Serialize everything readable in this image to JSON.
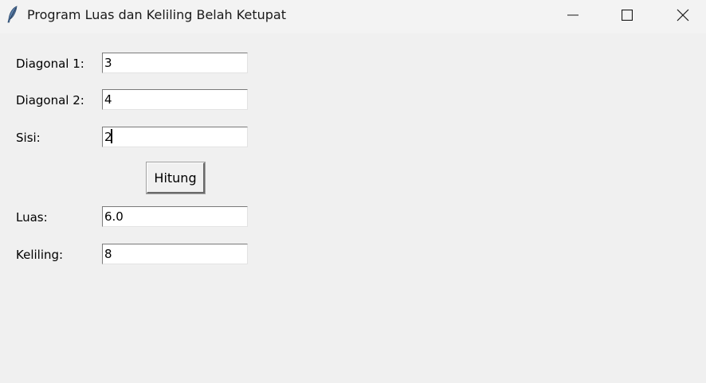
{
  "window": {
    "title": "Program Luas dan Keliling Belah Ketupat",
    "icon": "feather-icon"
  },
  "form": {
    "diagonal1": {
      "label": "Diagonal 1:",
      "value": "3"
    },
    "diagonal2": {
      "label": "Diagonal 2:",
      "value": "4"
    },
    "sisi": {
      "label": "Sisi:",
      "value": "2"
    },
    "hitung_button": "Hitung",
    "luas": {
      "label": "Luas:",
      "value": "6.0"
    },
    "keliling": {
      "label": "Keliling:",
      "value": "8"
    }
  }
}
